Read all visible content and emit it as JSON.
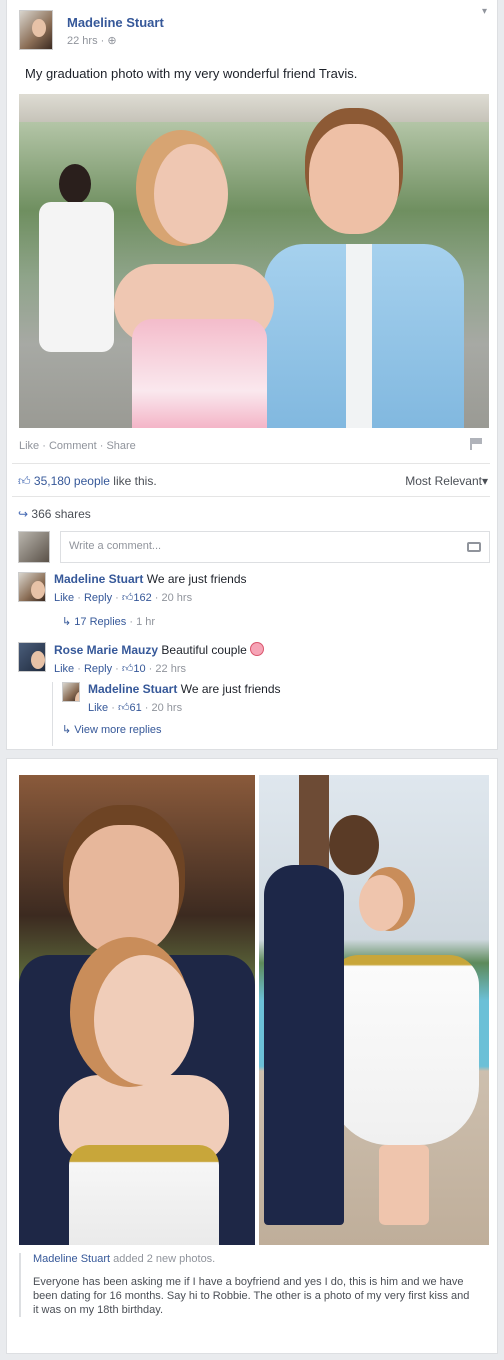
{
  "post": {
    "author": "Madeline Stuart",
    "time": "22 hrs · ",
    "privacy_icon": "globe-icon",
    "caption": "My graduation photo with my very wonderful friend Travis.",
    "actions": {
      "like": "Like",
      "comment": "Comment",
      "share": "Share",
      "sep": " · "
    },
    "likes_count": "35,180 people",
    "likes_suffix": " like this.",
    "sort_label": "Most Relevant",
    "shares": "366 shares",
    "comment_placeholder": "Write a comment..."
  },
  "comments": [
    {
      "author": "Madeline Stuart",
      "text": "We are just friends",
      "like": "Like",
      "reply": "Reply",
      "likes": "162",
      "time": "20 hrs",
      "replies_label": "17 Replies",
      "replies_time": "1 hr"
    },
    {
      "author": "Rose Marie Mauzy",
      "text": "Beautiful couple",
      "like": "Like",
      "reply": "Reply",
      "likes": "10",
      "time": "22 hrs"
    }
  ],
  "nested_reply": {
    "author": "Madeline Stuart",
    "text": "We are just friends",
    "like": "Like",
    "likes": "61",
    "time": "20 hrs",
    "more": "View more replies"
  },
  "post2": {
    "author": "Madeline Stuart",
    "action": " added 2 new photos.",
    "body": "Everyone has been asking me if I have a boyfriend and yes I do, this is him and we have been dating for 16 months. Say hi to Robbie. The other is a photo of my very first kiss and it was on my 18th birthday."
  },
  "colors": {
    "link": "#365899",
    "muted": "#90949c",
    "background": "#e9ebee"
  }
}
